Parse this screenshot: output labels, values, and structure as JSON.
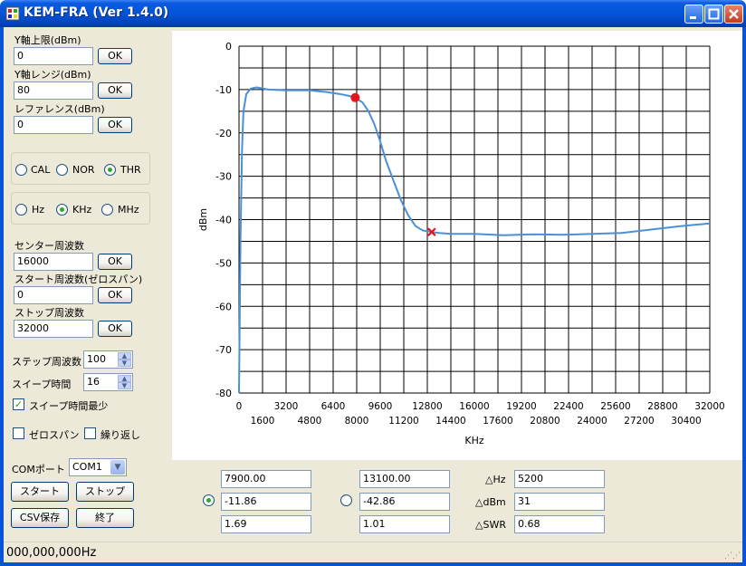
{
  "window": {
    "title": "KEM-FRA (Ver 1.4.0)"
  },
  "left_panel": {
    "y_top": {
      "label": "Y軸上限(dBm)",
      "value": "0",
      "ok": "OK"
    },
    "y_range": {
      "label": "Y軸レンジ(dBm)",
      "value": "80",
      "ok": "OK"
    },
    "reference": {
      "label": "レファレンス(dBm)",
      "value": "0",
      "ok": "OK"
    },
    "mode_group": {
      "options": [
        "CAL",
        "NOR",
        "THR"
      ],
      "selected": "THR"
    },
    "unit_group": {
      "options": [
        "Hz",
        "KHz",
        "MHz"
      ],
      "selected": "KHz"
    },
    "center_freq": {
      "label": "センター周波数",
      "value": "16000",
      "ok": "OK"
    },
    "start_freq": {
      "label": "スタート周波数(ゼロスパン)",
      "value": "0",
      "ok": "OK"
    },
    "stop_freq": {
      "label": "ストップ周波数",
      "value": "32000",
      "ok": "OK"
    },
    "step_freq": {
      "label": "ステップ周波数",
      "value": "100"
    },
    "sweep_time": {
      "label": "スイープ時間",
      "value": "16"
    },
    "sweep_min": {
      "label": "スイープ時間最少",
      "checked": true
    },
    "zero_span": {
      "label": "ゼロスパン",
      "checked": false
    },
    "repeat": {
      "label": "繰り返し",
      "checked": false
    },
    "com_port": {
      "label": "COMポート",
      "value": "COM1"
    },
    "buttons": {
      "start": "スタート",
      "stop": "ストップ",
      "csv": "CSV保存",
      "exit": "終了"
    }
  },
  "markers": {
    "marker1": {
      "hz": "7900.00",
      "dbm": "-11.86",
      "swr": "1.69",
      "selected": true
    },
    "marker2": {
      "hz": "13100.00",
      "dbm": "-42.86",
      "swr": "1.01",
      "selected": false
    },
    "delta": {
      "hz_label": "△Hz",
      "hz": "5200",
      "dbm_label": "△dBm",
      "dbm": "31",
      "swr_label": "△SWR",
      "swr": "0.68"
    }
  },
  "status": {
    "text": "000,000,000Hz"
  },
  "colors": {
    "trace": "#4a90d9",
    "marker1": "#e8141e",
    "marker2": "#e8141e",
    "title_bar": "#0454d8"
  },
  "chart_data": {
    "type": "line",
    "xlabel": "KHz",
    "ylabel": "dBm",
    "xlim": [
      0,
      32000
    ],
    "ylim": [
      -80,
      0
    ],
    "grid": true,
    "x_ticks_upper": [
      "0",
      "3200",
      "6400",
      "9600",
      "12800",
      "16000",
      "19200",
      "22400",
      "25600",
      "28800",
      "32000"
    ],
    "x_ticks_lower": [
      "1600",
      "4800",
      "8000",
      "11200",
      "14400",
      "17600",
      "20800",
      "24000",
      "27200",
      "30400"
    ],
    "y_ticks": [
      "0",
      "-10",
      "-20",
      "-30",
      "-40",
      "-50",
      "-60",
      "-70",
      "-80"
    ],
    "series": [
      {
        "x": [
          0,
          100,
          200,
          300,
          500,
          800,
          1200,
          2000,
          3200,
          4800,
          6000,
          6800,
          7400,
          7900,
          8400,
          8800,
          9200,
          9600,
          10000,
          10500,
          11000,
          11500,
          12000,
          12500,
          13100,
          13600,
          14400,
          16000,
          18000,
          20000,
          22000,
          24000,
          26000,
          28000,
          30000,
          32000
        ],
        "y": [
          -80,
          -45,
          -24,
          -15,
          -11,
          -9.8,
          -9.5,
          -10,
          -10.2,
          -10.2,
          -10.6,
          -11,
          -11.4,
          -11.86,
          -13,
          -15,
          -18,
          -22,
          -26.5,
          -31,
          -35.5,
          -39,
          -41.5,
          -42.5,
          -42.86,
          -43.1,
          -43.3,
          -43.3,
          -43.6,
          -43.4,
          -43.5,
          -43.3,
          -43.1,
          -42.3,
          -41.5,
          -40.9
        ]
      }
    ],
    "markers": [
      {
        "x": 7900,
        "y": -11.86,
        "shape": "circle"
      },
      {
        "x": 13100,
        "y": -42.86,
        "shape": "x"
      }
    ]
  }
}
